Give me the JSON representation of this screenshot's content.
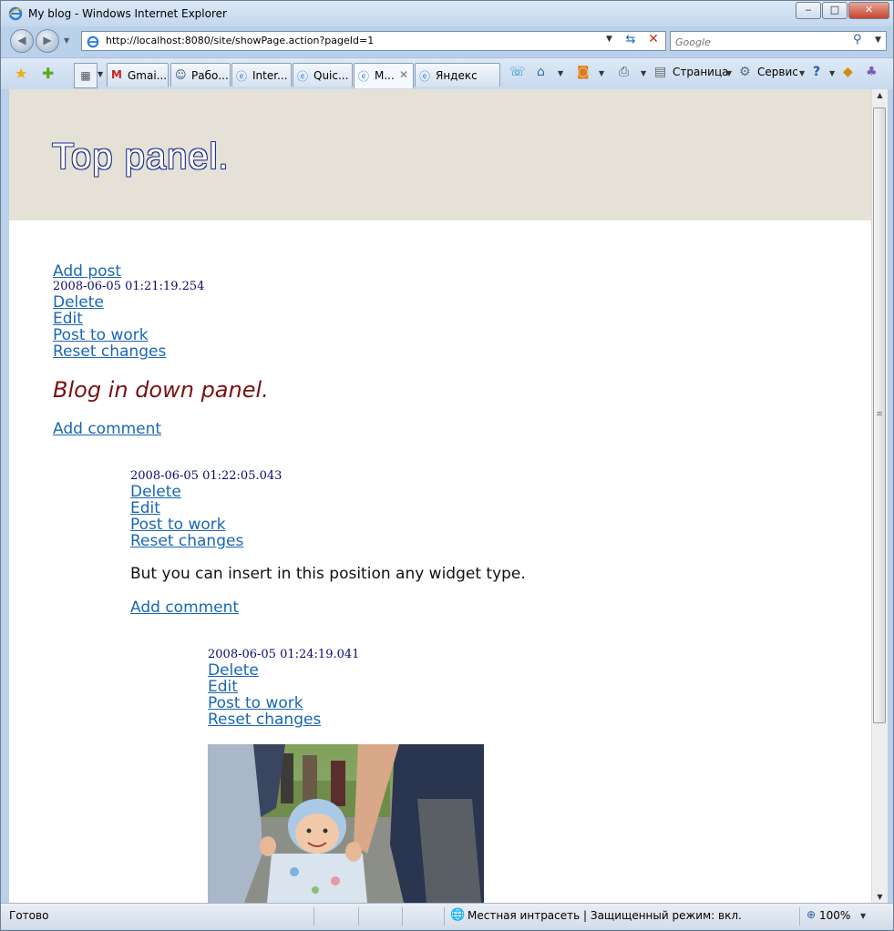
{
  "window": {
    "title": "My blog - Windows Internet Explorer",
    "minimize": "‒",
    "maximize": "□",
    "close": "✕"
  },
  "nav": {
    "back": "◀",
    "forward": "▶",
    "address": "http://localhost:8080/site/showPage.action?pageId=1",
    "search_placeholder": "Google"
  },
  "tabs": [
    {
      "label": "Gmai..."
    },
    {
      "label": "Рабо..."
    },
    {
      "label": "Inter..."
    },
    {
      "label": "Quic..."
    },
    {
      "label": "M..."
    },
    {
      "label": "Яндекс"
    }
  ],
  "commands": {
    "page": "Страница",
    "tools": "Сервис"
  },
  "page": {
    "top_panel": "Top panel.",
    "add_post": "Add post",
    "post": {
      "timestamp": "2008-06-05 01:21:19.254",
      "delete": "Delete",
      "edit": "Edit",
      "post_to_work": "Post to work",
      "reset": "Reset changes",
      "title": "Blog in down panel.",
      "add_comment": "Add comment"
    },
    "comment1": {
      "timestamp": "2008-06-05 01:22:05.043",
      "delete": "Delete",
      "edit": "Edit",
      "post_to_work": "Post to work",
      "reset": "Reset changes",
      "text": "But you can insert in this position any widget type.",
      "add_comment": "Add comment"
    },
    "comment2": {
      "timestamp": "2008-06-05 01:24:19.041",
      "delete": "Delete",
      "edit": "Edit",
      "post_to_work": "Post to work",
      "reset": "Reset changes"
    }
  },
  "status": {
    "ready": "Готово",
    "zone": "Местная интрасеть | Защищенный режим: вкл.",
    "zoom": "100%"
  }
}
